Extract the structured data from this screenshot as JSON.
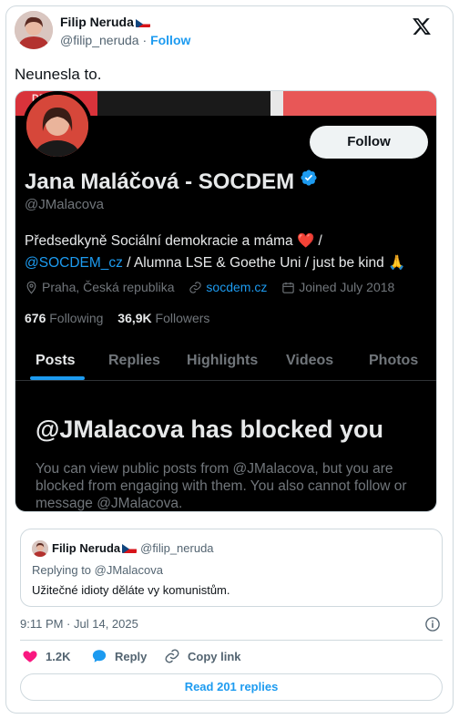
{
  "author": {
    "name": "Filip Neruda",
    "handle": "@filip_neruda",
    "separator": "·",
    "follow_label": "Follow"
  },
  "tweet": {
    "text": "Neunesla to.",
    "timestamp": "9:11 PM · Jul 14, 2025"
  },
  "screenshot": {
    "banner_text": "DEM",
    "follow_button": "Follow",
    "profile_name": "Jana Maláčová - SOCDEM",
    "profile_handle": "@JMalacova",
    "bio_line1": "Předsedkyně Sociální demokracie a máma ❤️ /",
    "bio_link": "@SOCDEM_cz",
    "bio_line2_rest": " / Alumna LSE & Goethe Uni / just be kind 🙏",
    "location": "Praha, Česká republika",
    "website": "socdem.cz",
    "joined": "Joined July 2018",
    "following_count": "676",
    "following_label": "Following",
    "followers_count": "36,9K",
    "followers_label": "Followers",
    "tabs": [
      "Posts",
      "Replies",
      "Highlights",
      "Videos",
      "Photos"
    ],
    "blocked_title": "@JMalacova has blocked you",
    "blocked_desc": "You can view public posts from @JMalacova, but you are blocked from engaging with them. You also cannot follow or message @JMalacova."
  },
  "quote": {
    "name": "Filip Neruda",
    "handle": "@filip_neruda",
    "replying": "Replying to @JMalacova",
    "text": "Užitečné idioty děláte vy komunistům."
  },
  "actions": {
    "like_count": "1.2K",
    "reply_label": "Reply",
    "copy_label": "Copy link",
    "read_replies": "Read 201 replies"
  },
  "colors": {
    "accent": "#1d9bf0",
    "like": "#f91880",
    "dark_bg": "#000000"
  },
  "icons": {
    "x_logo": "x-logo-icon",
    "verified": "verified-badge-icon",
    "location": "location-pin-icon",
    "link": "link-icon",
    "calendar": "calendar-icon",
    "info": "info-icon",
    "heart": "heart-icon",
    "reply": "speech-bubble-icon",
    "copy": "link-icon"
  }
}
